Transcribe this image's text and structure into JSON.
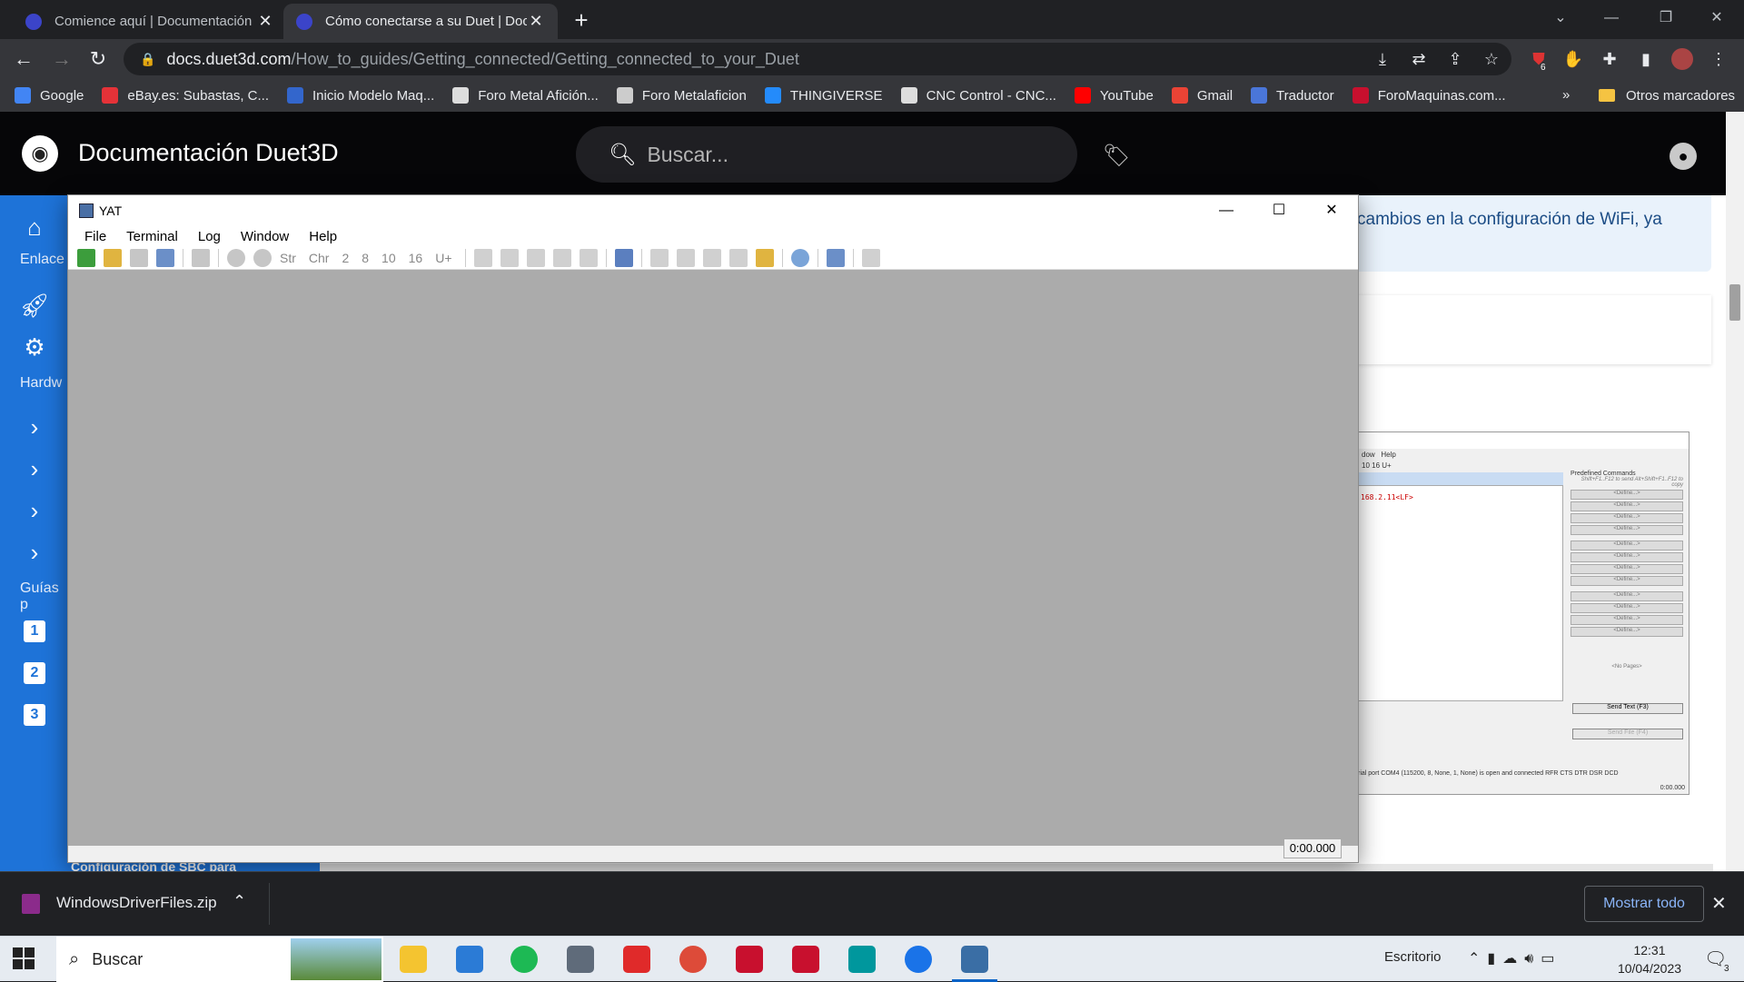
{
  "browser": {
    "tabs": [
      {
        "title": "Comience aquí | Documentación",
        "active": false
      },
      {
        "title": "Cómo conectarse a su Duet | Doc",
        "active": true
      }
    ],
    "new_tab": "+",
    "url_domain": "docs.duet3d.com",
    "url_path": "/How_to_guides/Getting_connected/Getting_connected_to_your_Duet",
    "extension_badge": "6"
  },
  "bookmarks": {
    "items": [
      "Google",
      "eBay.es: Subastas, C...",
      "Inicio Modelo Maq...",
      "Foro Metal Afición...",
      "Foro Metalaficion",
      "THINGIVERSE",
      "CNC Control - CNC...",
      "YouTube",
      "Gmail",
      "Traductor",
      "ForoMaquinas.com..."
    ],
    "colors": [
      "#4285f4",
      "#e53238",
      "#3366cc",
      "#dddddd",
      "#cccccc",
      "#248bfb",
      "#dddddd",
      "#ff0000",
      "#ea4335",
      "#4a76d9",
      "#c8102e"
    ],
    "more": "»",
    "other": "Otros marcadores"
  },
  "site": {
    "title": "Documentación Duet3D",
    "search_placeholder": "Buscar...",
    "nav_labels": {
      "enlaces": "Enlace",
      "hardware": "Hardw",
      "guias": "Guías p"
    },
    "nav_numbers": [
      "1",
      "2",
      "3"
    ],
    "info_text": "cambios en la configuración de WiFi, ya",
    "bottom_heading": "Configuración de SBC para"
  },
  "screenshot_thumb": {
    "menu": [
      "dow",
      "Help"
    ],
    "toolbar_numbers": "10  16  U+",
    "terminal_line": "168.2.11<LF>",
    "predefined_title": "Predefined Commands",
    "predefined_hint": "Shift+F1..F12 to send Alt+Shift+F1..F12 to copy",
    "define_label": "<Define...>",
    "no_pages": "<No Pages>",
    "send_text": "Send Text (F3)",
    "send_file": "Send File (F4)",
    "status": "rial port COM4 (115200, 8, None, 1, None) is open and connected  RFR  CTS  DTR  DSR  DCD",
    "time": "0:00.000"
  },
  "yat": {
    "title": "YAT",
    "menu": [
      "File",
      "Terminal",
      "Log",
      "Window",
      "Help"
    ],
    "toolbar_text": [
      "Str",
      "Chr",
      "2",
      "8",
      "10",
      "16",
      "U+"
    ],
    "time": "0:00.000"
  },
  "download": {
    "filename": "WindowsDriverFiles.zip",
    "show_all": "Mostrar todo"
  },
  "taskbar": {
    "search": "Buscar",
    "escritorio": "Escritorio",
    "time": "12:31",
    "date": "10/04/2023",
    "notifications": "3",
    "app_colors": [
      "#f4c430",
      "#2b7bd6",
      "#1db954",
      "#5f6b7a",
      "#e02a2a",
      "#dd4b39",
      "#c8102e",
      "#c8102e",
      "#00979d",
      "#1a73e8",
      "#3a6ea5"
    ]
  }
}
